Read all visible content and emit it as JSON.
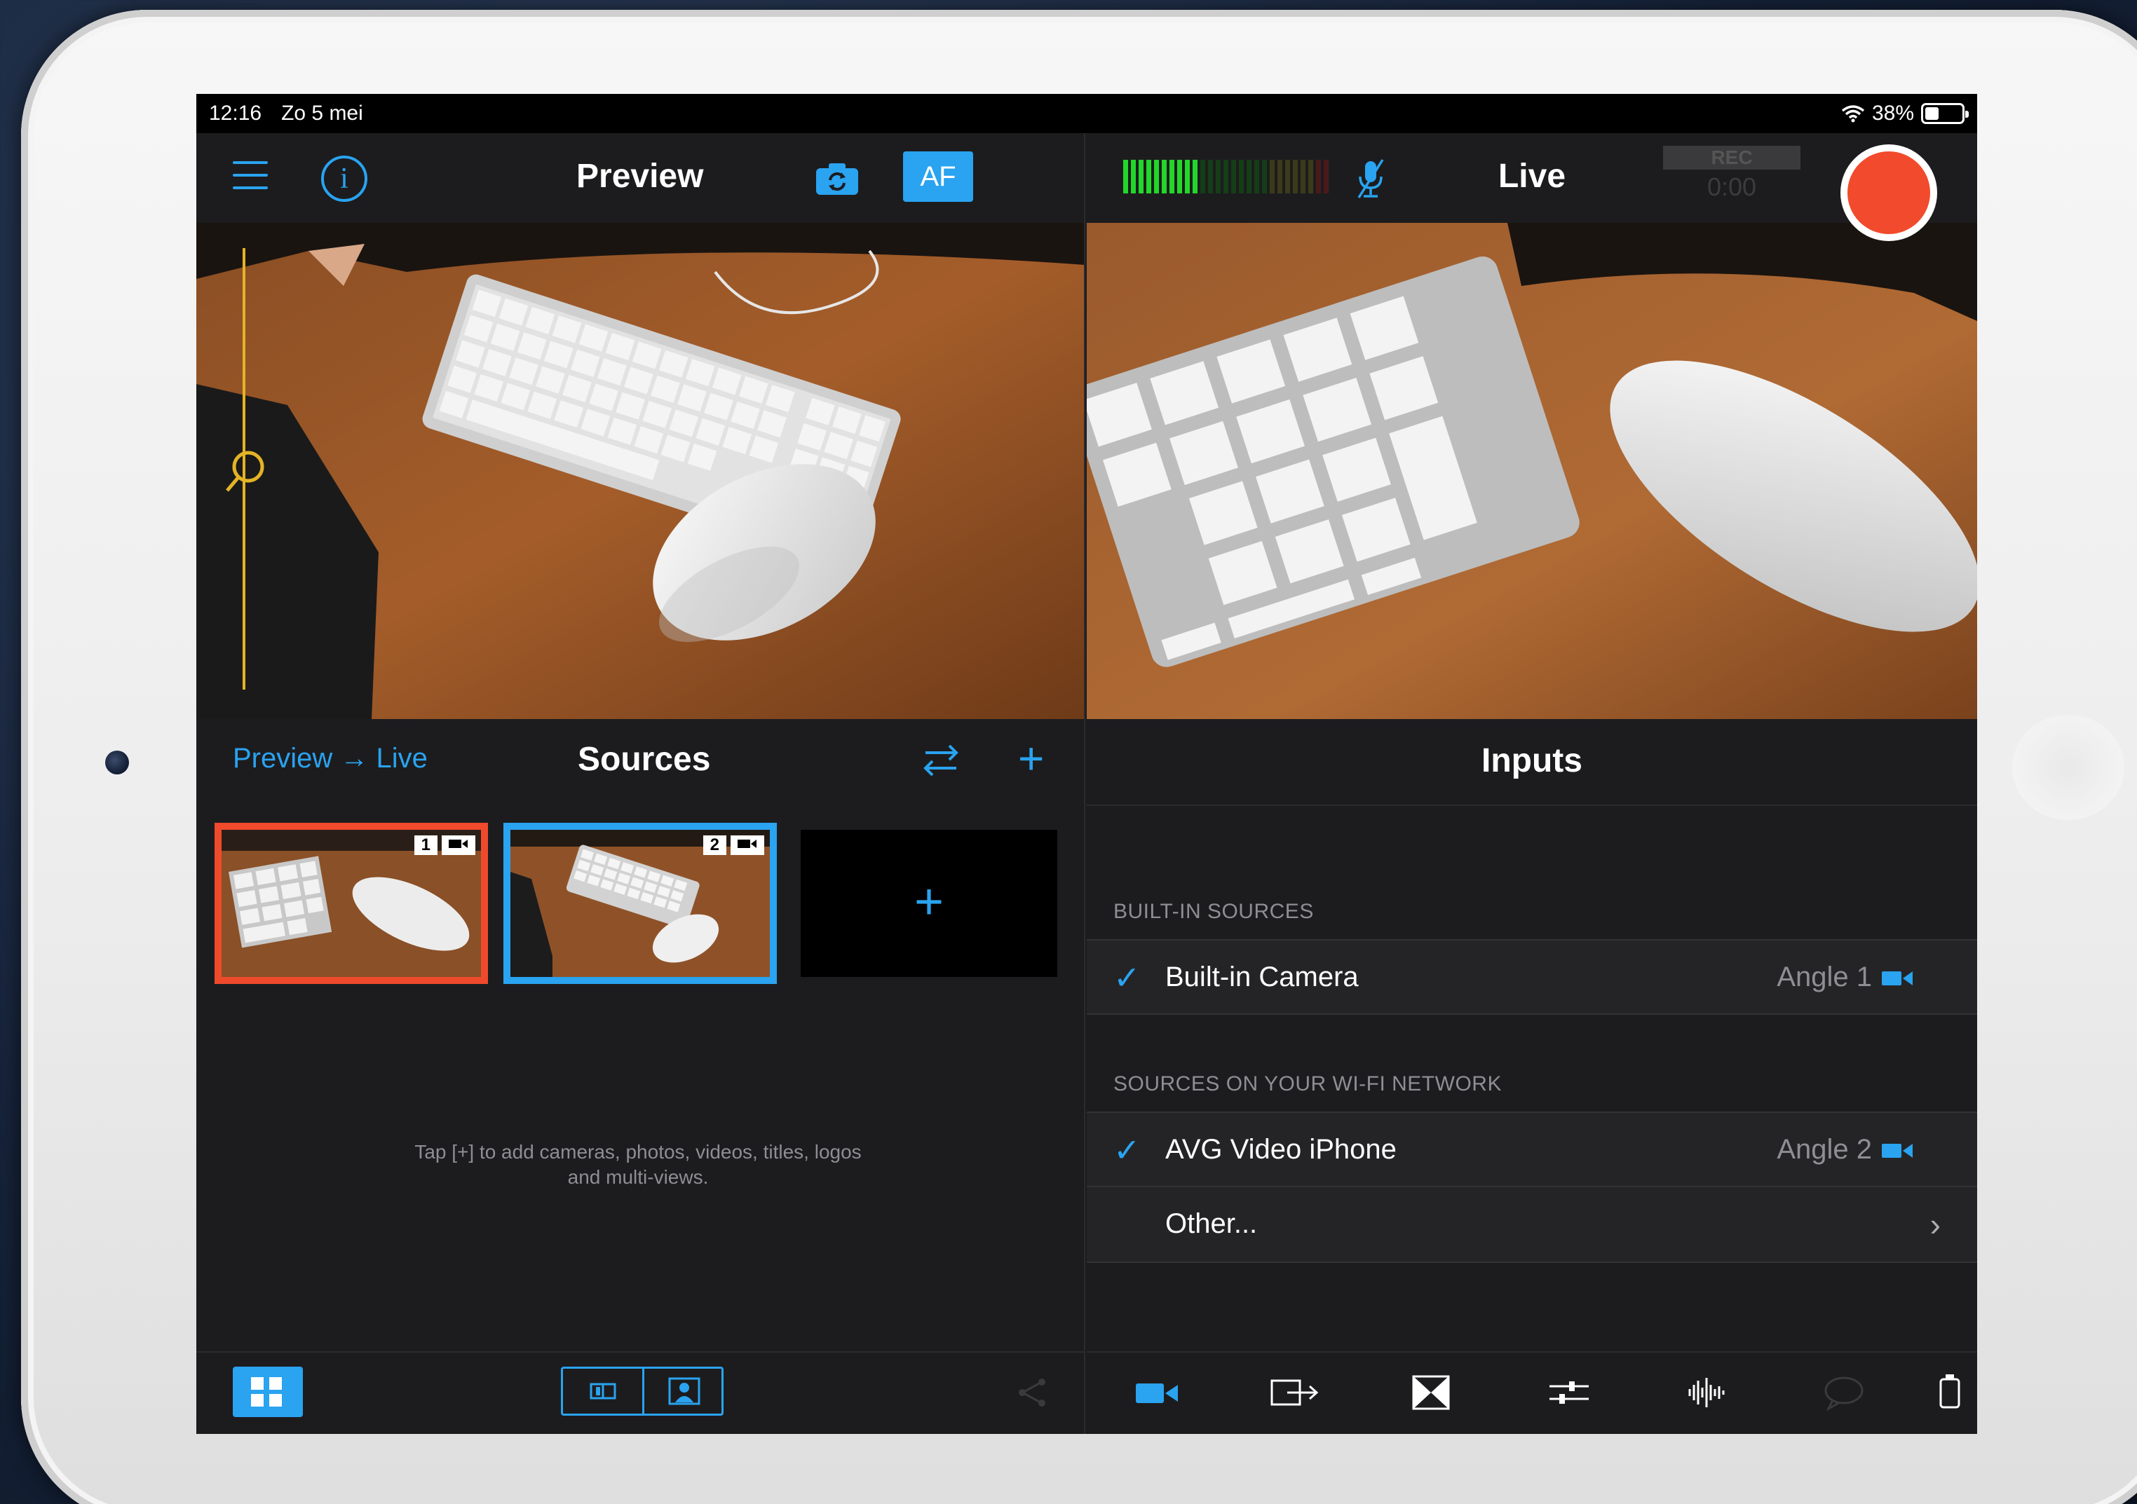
{
  "status_bar": {
    "time": "12:16",
    "date": "Zo 5 mei",
    "battery": "38%",
    "battery_level": 0.38
  },
  "preview": {
    "title": "Preview",
    "af_label": "AF"
  },
  "live": {
    "title": "Live",
    "rec_label": "REC",
    "rec_time": "0:00"
  },
  "audio_meter": {
    "lit_bars": 10,
    "total_bars": 27
  },
  "sources": {
    "title": "Sources",
    "route": {
      "from": "Preview",
      "to": "Live",
      "arrow": "→"
    },
    "tiles": [
      {
        "number": "1",
        "state": "live"
      },
      {
        "number": "2",
        "state": "preview"
      }
    ],
    "add_label": "+",
    "hint": "Tap [+] to add cameras, photos, videos, titles, logos and multi-views."
  },
  "inputs": {
    "title": "Inputs",
    "sections": [
      {
        "label": "BUILT-IN SOURCES",
        "items": [
          {
            "check": "✓",
            "label": "Built-in Camera",
            "angle": "Angle 1"
          }
        ]
      },
      {
        "label": "SOURCES ON YOUR WI-FI NETWORK",
        "items": [
          {
            "check": "✓",
            "label": "AVG Video iPhone",
            "angle": "Angle 2"
          },
          {
            "check": "",
            "label": "Other...",
            "angle": "",
            "chevron": "›"
          }
        ]
      }
    ]
  },
  "colors": {
    "accent": "#2aa3f0",
    "live_red": "#f04a2c",
    "zoom_yellow": "#e4b326",
    "meter_green": "#22d62a"
  },
  "icons": [
    "menu-icon",
    "info-icon",
    "camera-switch-icon",
    "mic-off-icon",
    "swap-icon",
    "add-icon",
    "grid-view-icon",
    "layout-icon",
    "person-icon",
    "share-icon",
    "video-camera-icon",
    "output-icon",
    "transition-icon",
    "sliders-icon",
    "audio-waveform-icon",
    "comment-icon",
    "timer-icon"
  ]
}
